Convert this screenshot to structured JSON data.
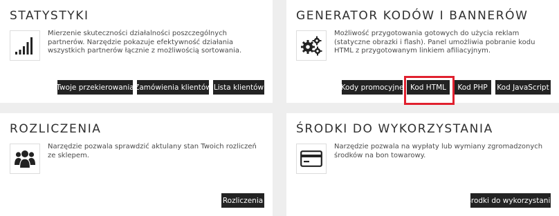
{
  "cards": {
    "statystyki": {
      "title": "STATYSTYKI",
      "description": "Mierzenie skuteczności działalności poszczególnych partnerów. Narzędzie pokazuje efektywność działania wszystkich partnerów łącznie z możliwością sortowania.",
      "icon": "bar-chart-icon",
      "buttons": [
        "Twoje przekierowania",
        "Zamówienia klientów",
        "Lista klientów"
      ]
    },
    "generator": {
      "title": "GENERATOR KODÓW I BANNERÓW",
      "description": "Możliwość przygotowania gotowych do użycia reklam (statyczne obrazki i flash). Panel umożliwia pobranie kodu HTML z przygotowanym linkiem afiliacyjnym.",
      "icon": "gears-icon",
      "buttons": [
        "Kody promocyjne",
        "Kod HTML",
        "Kod PHP",
        "Kod JavaScript"
      ]
    },
    "rozliczenia": {
      "title": "ROZLICZENIA",
      "description": "Narzędzie pozwala sprawdzić aktulany stan Twoich rozliczeń ze sklepem.",
      "icon": "users-icon",
      "buttons": [
        "Rozliczenia"
      ]
    },
    "srodki": {
      "title": "ŚRODKI DO WYKORZYSTANIA",
      "description": "Narzędzie pozwala na wypłaty lub wymiany zgromadzonych środków na bon towarowy.",
      "icon": "credit-card-icon",
      "buttons": [
        "Środki do wykorzystania"
      ]
    }
  },
  "highlight_color": "#e0202e",
  "button_color": "#232323"
}
